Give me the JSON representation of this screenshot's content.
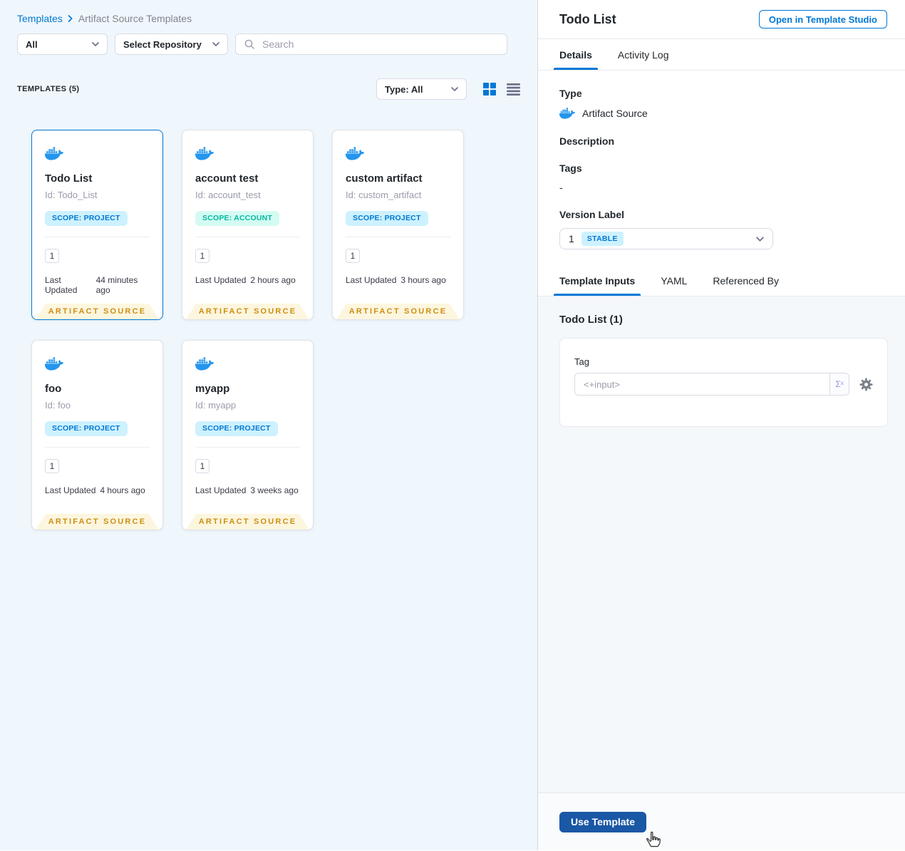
{
  "breadcrumb": {
    "root": "Templates",
    "current": "Artifact Source Templates"
  },
  "filters": {
    "scope": "All",
    "repository": "Select Repository",
    "search_placeholder": "Search"
  },
  "list_header": {
    "count_label": "TEMPLATES (5)",
    "type_filter": "Type: All"
  },
  "cards": [
    {
      "name": "Todo List",
      "id": "Id: Todo_List",
      "scope": "SCOPE: PROJECT",
      "scope_type": "project",
      "version": "1",
      "updated_label": "Last Updated",
      "updated": "44 minutes ago",
      "ribbon": "ARTIFACT SOURCE",
      "selected": true
    },
    {
      "name": "account test",
      "id": "Id: account_test",
      "scope": "SCOPE: ACCOUNT",
      "scope_type": "account",
      "version": "1",
      "updated_label": "Last Updated",
      "updated": "2 hours ago",
      "ribbon": "ARTIFACT SOURCE",
      "selected": false
    },
    {
      "name": "custom artifact",
      "id": "Id: custom_artifact",
      "scope": "SCOPE: PROJECT",
      "scope_type": "project",
      "version": "1",
      "updated_label": "Last Updated",
      "updated": "3 hours ago",
      "ribbon": "ARTIFACT SOURCE",
      "selected": false
    },
    {
      "name": "foo",
      "id": "Id: foo",
      "scope": "SCOPE: PROJECT",
      "scope_type": "project",
      "version": "1",
      "updated_label": "Last Updated",
      "updated": "4 hours ago",
      "ribbon": "ARTIFACT SOURCE",
      "selected": false
    },
    {
      "name": "myapp",
      "id": "Id: myapp",
      "scope": "SCOPE: PROJECT",
      "scope_type": "project",
      "version": "1",
      "updated_label": "Last Updated",
      "updated": "3 weeks ago",
      "ribbon": "ARTIFACT SOURCE",
      "selected": false
    }
  ],
  "details": {
    "title": "Todo List",
    "open_button": "Open in Template Studio",
    "tabs": [
      "Details",
      "Activity Log"
    ],
    "type_label": "Type",
    "type_value": "Artifact Source",
    "description_label": "Description",
    "tags_label": "Tags",
    "tags_value": "-",
    "version_label": "Version Label",
    "version_value": "1",
    "version_badge": "STABLE"
  },
  "inputs": {
    "tabs": [
      "Template Inputs",
      "YAML",
      "Referenced By"
    ],
    "section_title": "Todo List (1)",
    "tag_label": "Tag",
    "tag_value": "<+input>",
    "expression_button": "Σˣ"
  },
  "footer": {
    "use_template": "Use Template"
  },
  "colors": {
    "primary_blue": "#0278d5",
    "docker_blue": "#2496ed",
    "scope_project_bg": "#cdf1fe",
    "scope_account_text": "#01b9a2",
    "ribbon_bg": "#fdf6df",
    "ribbon_text": "#cf8e12",
    "use_template_bg": "#1a57a5",
    "content_bg": "#f4f8fb",
    "left_panel_bg": "#eff7fc"
  }
}
